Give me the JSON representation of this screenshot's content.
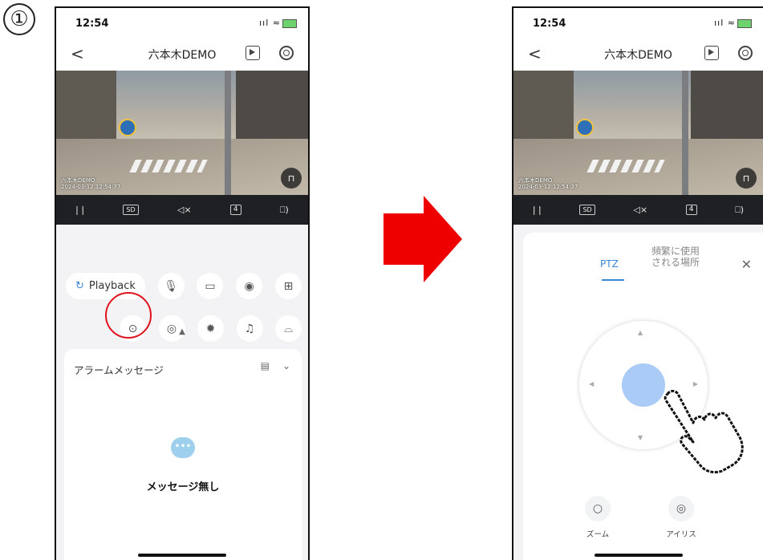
{
  "step_number": "①",
  "left_phone": {
    "status": {
      "time": "12:54",
      "signal": "ııl ≈"
    },
    "navbar": {
      "back": "<",
      "title": "六本木DEMO"
    },
    "video": {
      "osd_line1": "六本木DEMO",
      "osd_line2": "2024-03-12 12:54:37"
    },
    "toolbar": {
      "pause": "| |",
      "quality": "SD",
      "mute": "◁×",
      "split": "4",
      "device": "⎕)"
    },
    "controls": {
      "playback_label": "Playback",
      "row1_icons": [
        "microphone-icon",
        "record-icon",
        "camera-icon",
        "layout-icon"
      ],
      "row2_icons": [
        "ptz-icon",
        "eye-icon",
        "light-icon",
        "bell-icon",
        "wiper-icon"
      ]
    },
    "alarm": {
      "title": "アラームメッセージ",
      "empty_text": "メッセージ無し"
    }
  },
  "right_phone": {
    "status": {
      "time": "12:54",
      "signal": "ııl ≈"
    },
    "navbar": {
      "back": "<",
      "title": "六本木DEMO"
    },
    "video": {
      "osd_line1": "六本木DEMO",
      "osd_line2": "2024-03-12 12:54:37"
    },
    "toolbar": {
      "pause": "| |",
      "quality": "SD",
      "mute": "◁×",
      "split": "4",
      "device": "⎕)"
    },
    "ptz": {
      "tab_ptz": "PTZ",
      "tab_frequent": "頻繁に使用\nされる場所",
      "zoom_label": "ズーム",
      "iris_label": "アイリス"
    }
  },
  "colors": {
    "accent": "#3a86d6",
    "highlight": "#e0121b",
    "arrow": "#ee0000",
    "knob": "#a9cbf6"
  }
}
